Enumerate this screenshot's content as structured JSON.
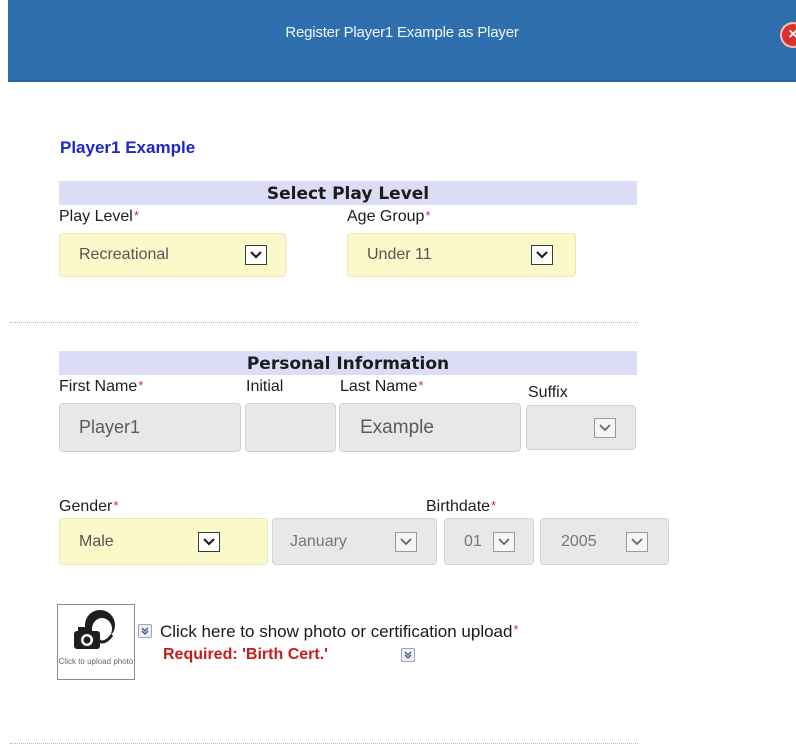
{
  "dialog": {
    "title": "Register Player1 Example as Player",
    "close_symbol": "×"
  },
  "player_name": "Player1 Example",
  "play_level_section": {
    "heading": "Select Play Level",
    "play_level_label": "Play Level",
    "play_level_value": "Recreational",
    "age_group_label": "Age Group",
    "age_group_value": "Under 11"
  },
  "personal_section": {
    "heading": "Personal Information",
    "first_name_label": "First Name",
    "first_name_value": "Player1",
    "initial_label": "Initial",
    "initial_value": "",
    "last_name_label": "Last Name",
    "last_name_value": "Example",
    "suffix_label": "Suffix",
    "suffix_value": "",
    "gender_label": "Gender",
    "gender_value": "Male",
    "birthdate_label": "Birthdate",
    "birth_month": "January",
    "birth_day": "01",
    "birth_year": "2005"
  },
  "upload": {
    "camera_caption": "Click to upload photo",
    "link_text": "Click here to show photo or certification upload",
    "required_text": "Required:  'Birth Cert.'"
  },
  "required_marker": "*",
  "colors": {
    "header_bg": "#2f6fae",
    "section_bar": "#dcdcf6",
    "required_field_bg": "#fbf8c9",
    "disabled_field_bg": "#e8e8e8",
    "required_red": "#c81d1d",
    "name_blue": "#1a27c9"
  },
  "icons": {
    "close": "close-icon",
    "dropdown": "chevron-down-icon",
    "camera": "camera-icon",
    "expand": "double-chevron-down-icon"
  }
}
